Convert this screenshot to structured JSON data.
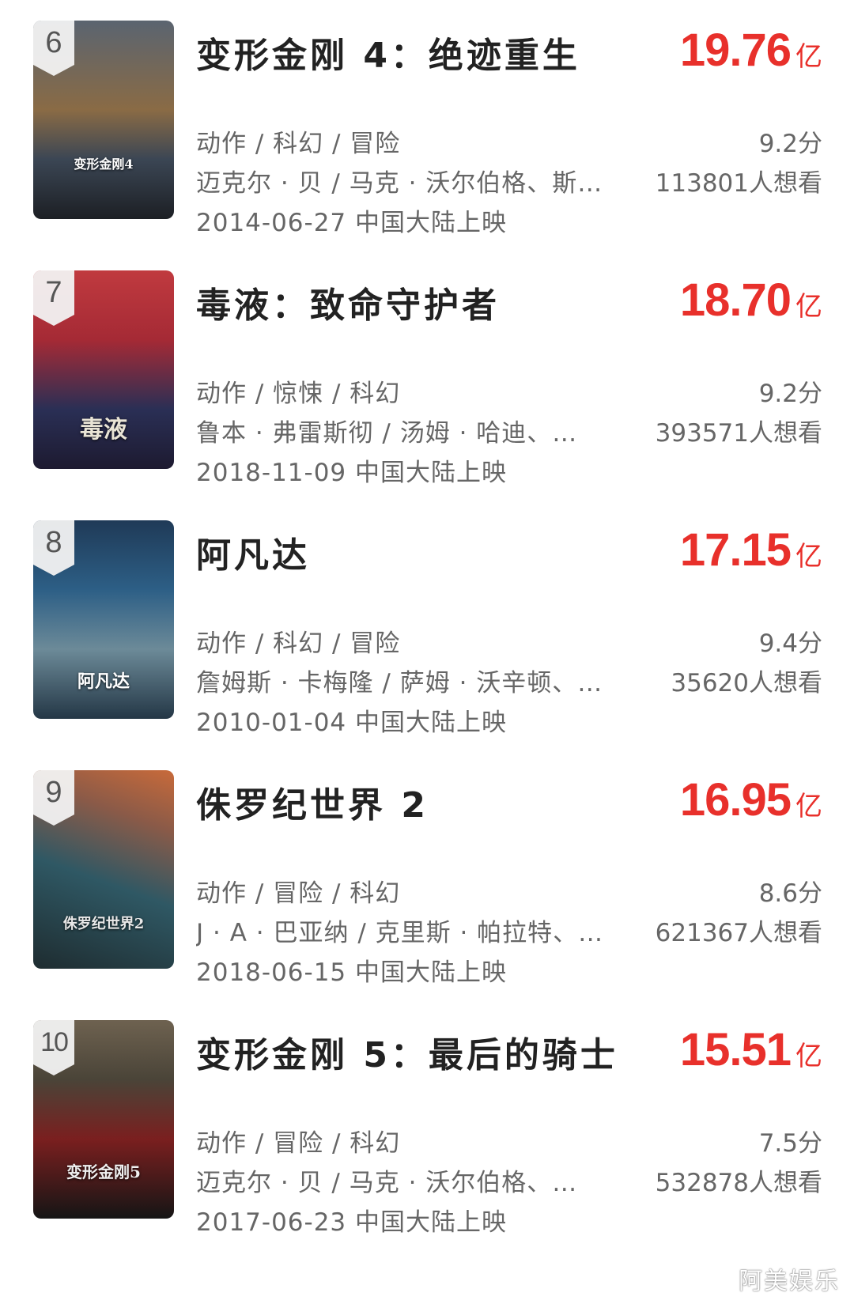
{
  "movies": [
    {
      "rank": "6",
      "title": "变形金刚 4：绝迹重生",
      "gross": "19.76",
      "gross_unit": "亿",
      "genres": "动作 / 科幻 / 冒险",
      "score": "9.2分",
      "cast": "迈克尔 · 贝 / 马克 · 沃尔伯格、斯…",
      "wants": "113801人想看",
      "release": "2014-06-27 中国大陆上映",
      "poster_caption": "变形金刚4",
      "poster_colors": [
        "#3b4654",
        "#8a6b45",
        "#1c1f24"
      ]
    },
    {
      "rank": "7",
      "title": "毒液：致命守护者",
      "gross": "18.70",
      "gross_unit": "亿",
      "genres": "动作 / 惊悚 / 科幻",
      "score": "9.2分",
      "cast": "鲁本 · 弗雷斯彻 / 汤姆 · 哈迪、…",
      "wants": "393571人想看",
      "release": "2018-11-09 中国大陆上映",
      "poster_caption": "毒液",
      "poster_colors": [
        "#b8323a",
        "#2a2f55",
        "#1d1a30"
      ]
    },
    {
      "rank": "8",
      "title": "阿凡达",
      "gross": "17.15",
      "gross_unit": "亿",
      "genres": "动作 / 科幻 / 冒险",
      "score": "9.4分",
      "cast": "詹姆斯 · 卡梅隆 / 萨姆 · 沃辛顿、…",
      "wants": "35620人想看",
      "release": "2010-01-04 中国大陆上映",
      "poster_caption": "阿凡达",
      "poster_colors": [
        "#2d5f86",
        "#6c8a98",
        "#243746"
      ]
    },
    {
      "rank": "9",
      "title": "侏罗纪世界 2",
      "gross": "16.95",
      "gross_unit": "亿",
      "genres": "动作 / 冒险 / 科幻",
      "score": "8.6分",
      "cast": "J · A · 巴亚纳 / 克里斯 · 帕拉特、…",
      "wants": "621367人想看",
      "release": "2018-06-15 中国大陆上映",
      "poster_caption": "侏罗纪世界2",
      "poster_colors": [
        "#2f5864",
        "#c86a3a",
        "#1e2c30"
      ]
    },
    {
      "rank": "10",
      "title": "变形金刚 5：最后的骑士",
      "gross": "15.51",
      "gross_unit": "亿",
      "genres": "动作 / 冒险 / 科幻",
      "score": "7.5分",
      "cast": "迈克尔 · 贝 / 马克 · 沃尔伯格、…",
      "wants": "532878人想看",
      "release": "2017-06-23 中国大陆上映",
      "poster_caption": "变形金刚5",
      "poster_colors": [
        "#4a4438",
        "#7a1f1f",
        "#151515"
      ]
    }
  ],
  "watermark": "阿美娱乐",
  "colors": {
    "gross_red": "#e8302b",
    "title_text": "#222222",
    "meta_text": "#666666"
  }
}
